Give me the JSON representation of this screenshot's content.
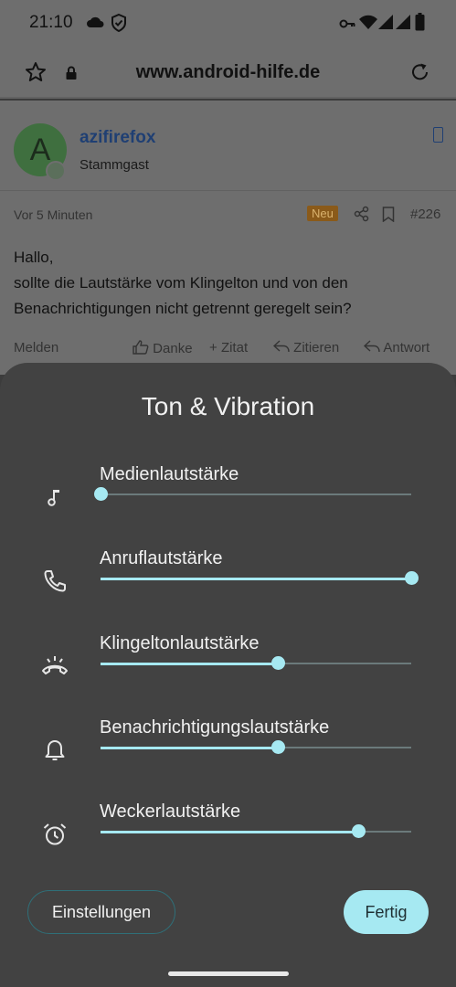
{
  "status_bar": {
    "time": "21:10",
    "icons_left": [
      "cloud-icon",
      "shield-icon"
    ],
    "icons_right": [
      "vpn-key-icon",
      "wifi-icon",
      "signal-icon",
      "signal-icon",
      "battery-icon"
    ]
  },
  "browser": {
    "url": "www.android-hilfe.de",
    "icons": [
      "star-icon",
      "lock-icon",
      "reload-icon"
    ]
  },
  "post": {
    "avatar_letter": "A",
    "username": "azifirefox",
    "role": "Stammgast",
    "time_ago": "Vor 5 Minuten",
    "badge": "Neu",
    "number": "#226",
    "lines": [
      "Hallo,",
      "sollte die Lautstärke vom Klingelton und von den",
      "Benachrichtigungen nicht getrennt geregelt sein?"
    ],
    "actions": {
      "report": "Melden",
      "like": "Danke",
      "quote": "Zitat",
      "cite": "Zitieren",
      "reply": "Antwort"
    }
  },
  "sheet": {
    "title": "Ton & Vibration",
    "sliders": [
      {
        "label": "Medienlautstärke",
        "icon": "music-note-icon",
        "value": 0.0
      },
      {
        "label": "Anruflautstärke",
        "icon": "phone-icon",
        "value": 1.0
      },
      {
        "label": "Klingeltonlautstärke",
        "icon": "ringer-icon",
        "value": 0.57
      },
      {
        "label": "Benachrichtigungslautstärke",
        "icon": "bell-icon",
        "value": 0.57
      },
      {
        "label": "Weckerlautstärke",
        "icon": "alarm-icon",
        "value": 0.83
      }
    ],
    "settings_button": "Einstellungen",
    "done_button": "Fertig"
  },
  "colors": {
    "accent": "#a6e9f2",
    "sheet_bg": "#424242",
    "scrim_page": "#6e6e6e"
  }
}
